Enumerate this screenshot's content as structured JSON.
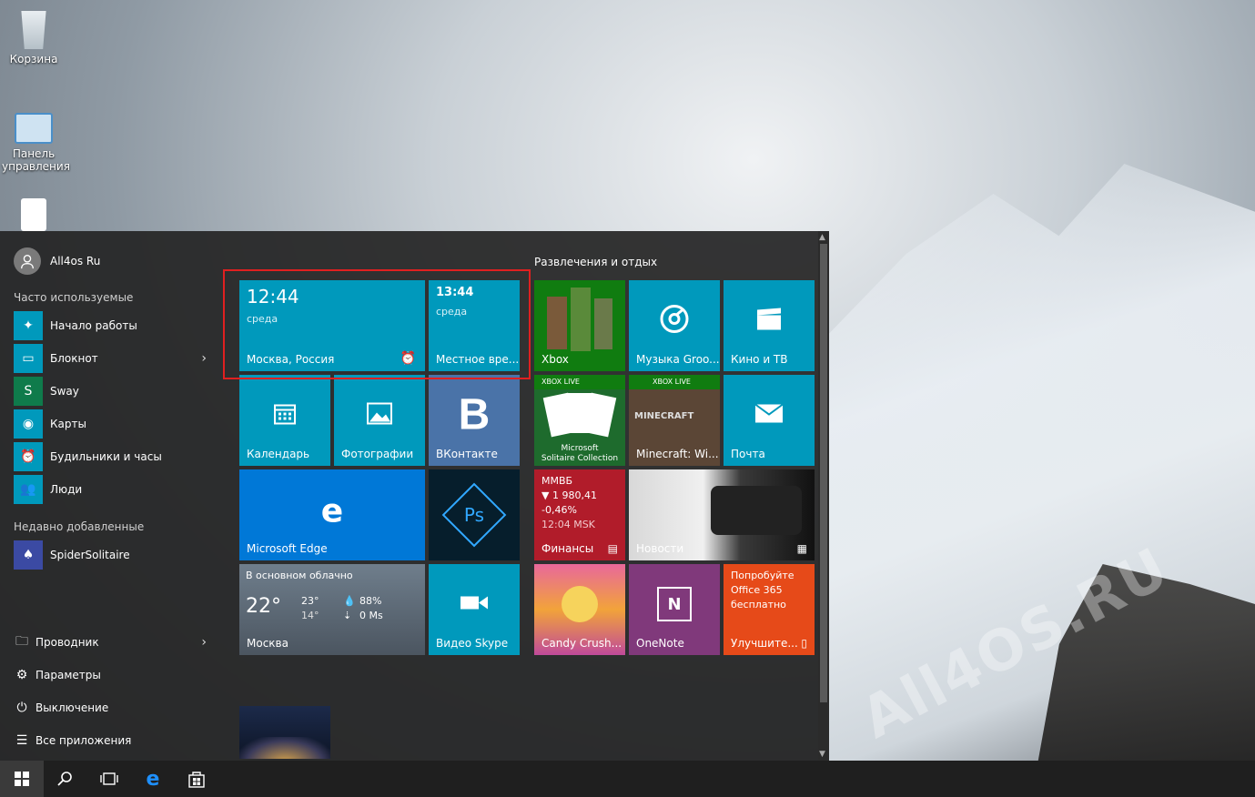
{
  "desktop": {
    "icons": [
      {
        "label": "Корзина"
      },
      {
        "label": "Панель управления"
      }
    ],
    "watermark": "All4OS.RU"
  },
  "start_menu": {
    "user": {
      "name": "All4os Ru"
    },
    "frequent": {
      "heading": "Часто используемые",
      "items": [
        {
          "label": "Начало работы",
          "icon": "lightbulb-icon"
        },
        {
          "label": "Блокнот",
          "icon": "notepad-icon"
        },
        {
          "label": "Sway",
          "icon": "sway-icon"
        },
        {
          "label": "Карты",
          "icon": "maps-icon"
        },
        {
          "label": "Будильники и часы",
          "icon": "alarm-icon"
        },
        {
          "label": "Люди",
          "icon": "people-icon"
        }
      ]
    },
    "recent": {
      "heading": "Недавно добавленные",
      "items": [
        {
          "label": "SpiderSolitaire",
          "icon": "solitaire-icon"
        }
      ]
    },
    "system": [
      {
        "label": "Проводник",
        "icon": "explorer-icon"
      },
      {
        "label": "Параметры",
        "icon": "gear-icon"
      },
      {
        "label": "Выключение",
        "icon": "power-icon"
      },
      {
        "label": "Все приложения",
        "icon": "list-icon"
      }
    ],
    "group_title": "Развлечения и отдых",
    "tiles": {
      "clock_moscow": {
        "time": "12:44",
        "day": "среда",
        "label": "Москва, Россия"
      },
      "clock_local": {
        "time": "13:44",
        "day": "среда",
        "label": "Местное вре..."
      },
      "calendar": {
        "label": "Календарь"
      },
      "photos": {
        "label": "Фотографии"
      },
      "vk": {
        "label": "ВКонтакте",
        "glyph": "B"
      },
      "edge": {
        "label": "Microsoft Edge",
        "glyph": "e"
      },
      "photoshop": {
        "glyph": "Ps"
      },
      "weather": {
        "condition": "В основном облачно",
        "temp": "22°",
        "high": "23°",
        "low": "14°",
        "humidity": "88%",
        "wind": "0 Ms",
        "city": "Москва"
      },
      "skype_video": {
        "label": "Видео Skype"
      },
      "xbox": {
        "label": "Xbox"
      },
      "groove": {
        "label": "Музыка Groo..."
      },
      "movies": {
        "label": "Кино и ТВ"
      },
      "solitaire": {
        "badge": "XBOX LIVE",
        "line1": "Microsoft",
        "line2": "Solitaire Collection"
      },
      "minecraft": {
        "badge": "XBOX LIVE",
        "art": "MINECRAFT",
        "label": "Minecraft: Wi..."
      },
      "mail": {
        "label": "Почта"
      },
      "finance": {
        "index": "ММВБ",
        "value": "▼ 1 980,41",
        "change": "-0,46%",
        "time": "12:04 MSK",
        "label": "Финансы"
      },
      "news": {
        "label": "Новости"
      },
      "candy": {
        "label": "Candy Crush..."
      },
      "onenote": {
        "label": "OneNote",
        "glyph": "N"
      },
      "office": {
        "line1": "Попробуйте",
        "line2": "Office 365",
        "line3": "бесплатно",
        "label": "Улучшите..."
      }
    }
  },
  "colors": {
    "tile_teal": "#0099bc",
    "edge_blue": "#0078d7",
    "finance_red": "#b11c2a",
    "onenote_purple": "#80397b",
    "office_orange": "#e64a19",
    "highlight": "#e02020"
  }
}
